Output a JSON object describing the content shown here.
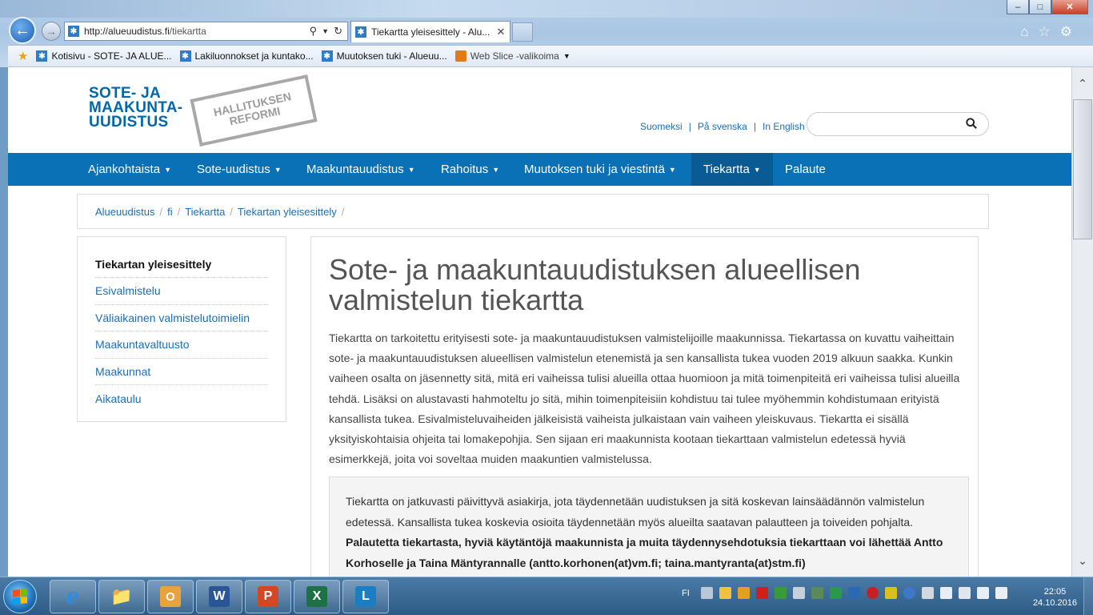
{
  "browser": {
    "url_host": "http://alueuudistus.fi",
    "url_path": "/tiekartta",
    "tab_title": "Tiekartta yleisesittely - Alu...",
    "favorites": [
      {
        "label": "Kotisivu - SOTE- JA ALUE..."
      },
      {
        "label": "Lakiluonnokset ja kuntako..."
      },
      {
        "label": "Muutoksen tuki - Alueuu..."
      }
    ],
    "web_slice_label": "Web Slice -valikoima"
  },
  "site": {
    "logo_lines": [
      "SOTE- JA",
      "MAAKUNTA-",
      "UUDISTUS"
    ],
    "stamp_lines": [
      "HALLITUKSEN",
      "REFORMI"
    ],
    "languages": [
      "Suomeksi",
      "På svenska",
      "In English"
    ],
    "search_placeholder": ""
  },
  "nav": {
    "items": [
      {
        "label": "Ajankohtaista",
        "dropdown": true
      },
      {
        "label": "Sote-uudistus",
        "dropdown": true
      },
      {
        "label": "Maakuntauudistus",
        "dropdown": true
      },
      {
        "label": "Rahoitus",
        "dropdown": true
      },
      {
        "label": "Muutoksen tuki ja viestintä",
        "dropdown": true
      },
      {
        "label": "Tiekartta",
        "dropdown": true,
        "active": true
      },
      {
        "label": "Palaute",
        "dropdown": false
      }
    ]
  },
  "breadcrumb": [
    "Alueuudistus",
    "fi",
    "Tiekartta",
    "Tiekartan yleisesittely"
  ],
  "sidebar": {
    "items": [
      {
        "label": "Tiekartan yleisesittely",
        "current": true
      },
      {
        "label": "Esivalmistelu"
      },
      {
        "label": "Väliaikainen valmistelutoimielin"
      },
      {
        "label": "Maakuntavaltuusto"
      },
      {
        "label": "Maakunnat"
      },
      {
        "label": "Aikataulu"
      }
    ]
  },
  "article": {
    "title": "Sote- ja maakuntauudistuksen alueellisen valmistelun tiekartta",
    "intro": "Tiekartta on tarkoitettu erityisesti sote- ja maakuntauudistuksen valmistelijoille maakunnissa. Tiekartassa on kuvattu vaiheittain sote- ja maakuntauudistuksen alueellisen valmistelun etenemistä ja sen kansallista tukea vuoden 2019 alkuun saakka. Kunkin vaiheen osalta on jäsennetty sitä, mitä eri vaiheissa tulisi alueilla ottaa huomioon ja mitä toimenpiteitä eri vaiheissa tulisi alueilla tehdä. Lisäksi on alustavasti hahmoteltu jo sitä, mihin toimenpiteisiin kohdistuu tai tulee myöhemmin kohdistumaan erityistä kansallista tukea. Esivalmisteluvaiheiden jälkeisistä vaiheista julkaistaan vain vaiheen yleiskuvaus.  Tiekartta ei sisällä yksityiskohtaisia ohjeita tai lomakepohjia. Sen sijaan eri maakunnista kootaan  tiekarttaan valmistelun edetessä hyviä esimerkkejä, joita voi soveltaa muiden maakuntien valmistelussa.",
    "infobox_text": "Tiekartta on jatkuvasti päivittyvä asiakirja, jota täydennetään uudistuksen ja sitä koskevan lainsäädännön valmistelun edetessä. Kansallista tukea koskevia osioita täydennetään myös alueilta saatavan palautteen ja toiveiden pohjalta.",
    "infobox_bold": "Palautetta tiekartasta, hyviä käytäntöjä maakunnista ja muita täydennysehdotuksia tiekarttaan voi lähettää Antto Korhoselle ja Taina Mäntyrannalle (antto.korhonen(at)vm.fi; taina.mantyranta(at)stm.fi)"
  },
  "taskbar": {
    "language": "FI",
    "time": "22:05",
    "date": "24.10.2016",
    "apps": [
      "internet-explorer",
      "windows-explorer",
      "outlook",
      "word",
      "powerpoint",
      "excel",
      "lync"
    ]
  },
  "colors": {
    "brand_blue": "#0a71b6",
    "nav_active": "#0a5a94",
    "link": "#1a6eb7",
    "logo": "#0067ab"
  }
}
